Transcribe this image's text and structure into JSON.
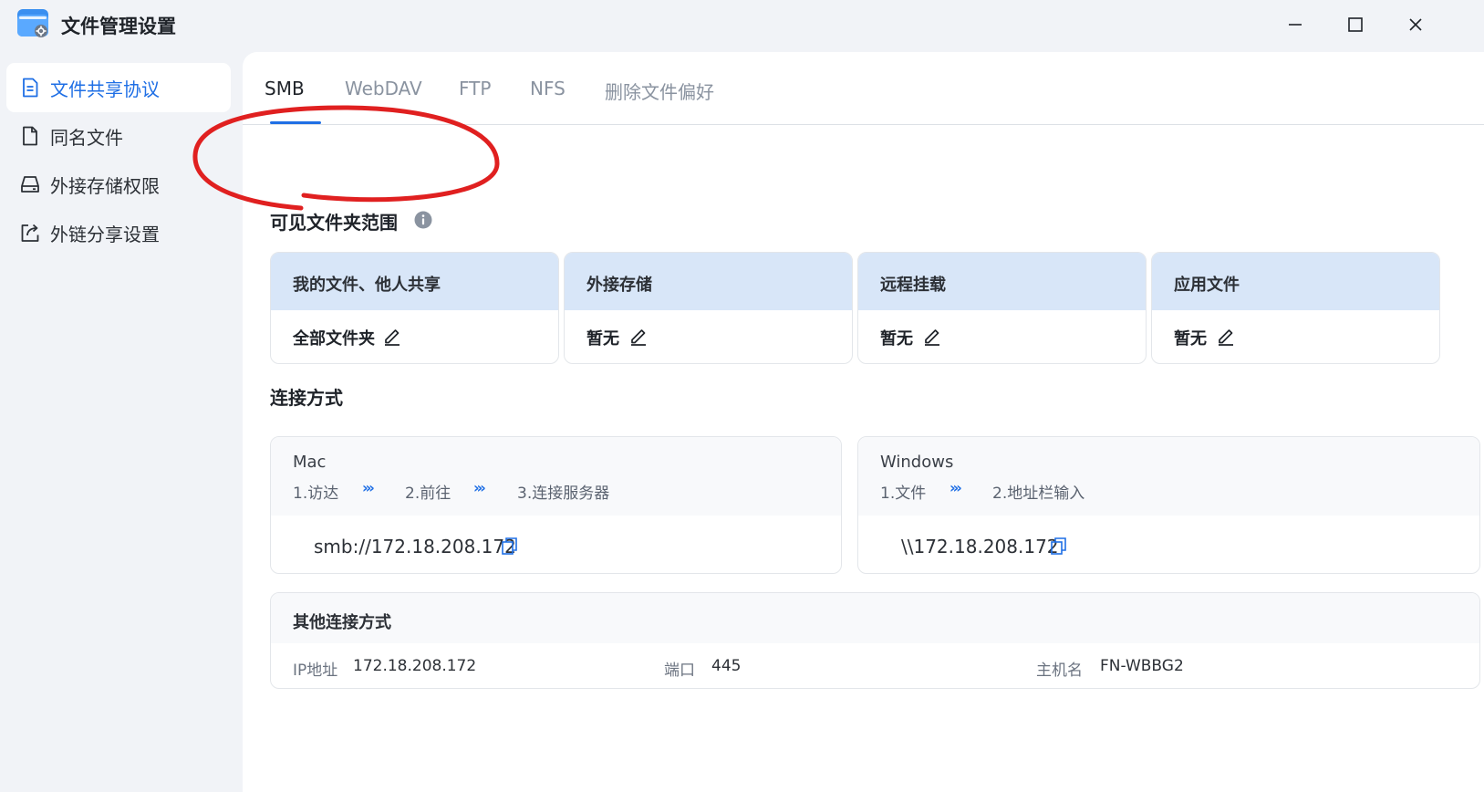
{
  "window": {
    "title": "文件管理设置",
    "icon": "folder-settings-icon",
    "controls": [
      "minimize-icon",
      "maximize-icon",
      "close-icon"
    ]
  },
  "sidebar": {
    "items": [
      {
        "label": "文件共享协议",
        "icon": "document-icon",
        "active": true
      },
      {
        "label": "同名文件",
        "icon": "file-icon",
        "active": false
      },
      {
        "label": "外接存储权限",
        "icon": "drive-icon",
        "active": false
      },
      {
        "label": "外链分享设置",
        "icon": "share-link-icon",
        "active": false
      }
    ]
  },
  "tabs": [
    {
      "label": "SMB",
      "active": true
    },
    {
      "label": "WebDAV",
      "active": false
    },
    {
      "label": "FTP",
      "active": false
    },
    {
      "label": "NFS",
      "active": false
    },
    {
      "label": "删除文件偏好",
      "active": false
    }
  ],
  "visible_scope": {
    "title": "可见文件夹范围",
    "cards": [
      {
        "header": "我的文件、他人共享",
        "value": "全部文件夹"
      },
      {
        "header": "外接存储",
        "value": "暂无"
      },
      {
        "header": "远程挂载",
        "value": "暂无"
      },
      {
        "header": "应用文件",
        "value": "暂无"
      }
    ]
  },
  "connection": {
    "title": "连接方式",
    "arrow": "›››",
    "mac": {
      "os": "Mac",
      "steps": [
        "1.访达",
        "2.前往",
        "3.连接服务器"
      ],
      "address": "smb://172.18.208.172"
    },
    "windows": {
      "os": "Windows",
      "steps": [
        "1.文件",
        "2.地址栏输入"
      ],
      "address": "\\\\172.18.208.172"
    }
  },
  "other_connection": {
    "title": "其他连接方式",
    "ip_label": "IP地址",
    "ip_value": "172.18.208.172",
    "port_label": "端口",
    "port_value": "445",
    "host_label": "主机名",
    "host_value": "FN-WBBG2"
  },
  "colors": {
    "accent": "#1f6fe5",
    "annotation": "#e02020",
    "card_header": "#d8e6f8"
  }
}
